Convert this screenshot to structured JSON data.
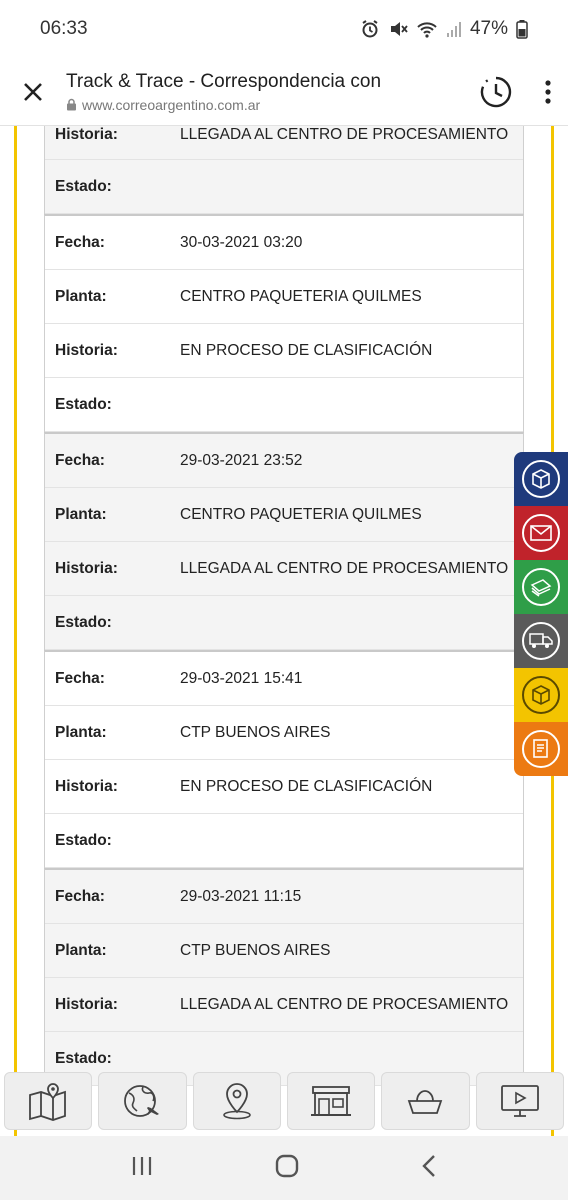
{
  "status_bar": {
    "time": "06:33",
    "battery": "47%",
    "icons": [
      "alarm-icon",
      "mute-icon",
      "wifi-icon",
      "signal-icon",
      "battery-icon"
    ]
  },
  "browser": {
    "title": "Track & Trace - Correspondencia con",
    "url": "www.correoargentino.com.ar",
    "icons": [
      "close-icon",
      "lock-icon",
      "history-icon",
      "more-icon"
    ]
  },
  "records": [
    {
      "rows": [
        {
          "label": "Historia:",
          "value": "LLEGADA AL CENTRO DE PROCESAMIENTO"
        },
        {
          "label": "Estado:",
          "value": ""
        }
      ]
    },
    {
      "rows": [
        {
          "label": "Fecha:",
          "value": "30-03-2021 03:20"
        },
        {
          "label": "Planta:",
          "value": "CENTRO PAQUETERIA QUILMES"
        },
        {
          "label": "Historia:",
          "value": "EN PROCESO DE CLASIFICACIÓN"
        },
        {
          "label": "Estado:",
          "value": ""
        }
      ]
    },
    {
      "rows": [
        {
          "label": "Fecha:",
          "value": "29-03-2021 23:52"
        },
        {
          "label": "Planta:",
          "value": "CENTRO PAQUETERIA QUILMES"
        },
        {
          "label": "Historia:",
          "value": "LLEGADA AL CENTRO DE PROCESAMIENTO"
        },
        {
          "label": "Estado:",
          "value": ""
        }
      ]
    },
    {
      "rows": [
        {
          "label": "Fecha:",
          "value": "29-03-2021 15:41"
        },
        {
          "label": "Planta:",
          "value": "CTP BUENOS AIRES"
        },
        {
          "label": "Historia:",
          "value": "EN PROCESO DE CLASIFICACIÓN"
        },
        {
          "label": "Estado:",
          "value": ""
        }
      ]
    },
    {
      "rows": [
        {
          "label": "Fecha:",
          "value": "29-03-2021 11:15"
        },
        {
          "label": "Planta:",
          "value": "CTP BUENOS AIRES"
        },
        {
          "label": "Historia:",
          "value": "LLEGADA AL CENTRO DE PROCESAMIENTO"
        },
        {
          "label": "Estado:",
          "value": ""
        }
      ]
    }
  ],
  "side_tabs": [
    {
      "icon": "package-icon",
      "color": "#1f3a7c"
    },
    {
      "icon": "envelope-icon",
      "color": "#c0232b"
    },
    {
      "icon": "money-icon",
      "color": "#2f9e48"
    },
    {
      "icon": "truck-icon",
      "color": "#5a5a5a"
    },
    {
      "icon": "box-icon",
      "color": "#f3c400"
    },
    {
      "icon": "document-icon",
      "color": "#ec7a12"
    }
  ],
  "bottom_dock": [
    {
      "icon": "map-icon"
    },
    {
      "icon": "globe-plane-icon"
    },
    {
      "icon": "location-pin-icon"
    },
    {
      "icon": "store-icon"
    },
    {
      "icon": "basket-icon"
    },
    {
      "icon": "monitor-play-icon"
    }
  ],
  "nav_bar": {
    "icons": [
      "recent-apps-icon",
      "home-icon",
      "back-icon"
    ]
  },
  "colors": {
    "accent_yellow": "#f3c400",
    "row_gray": "#f4f4f4"
  }
}
